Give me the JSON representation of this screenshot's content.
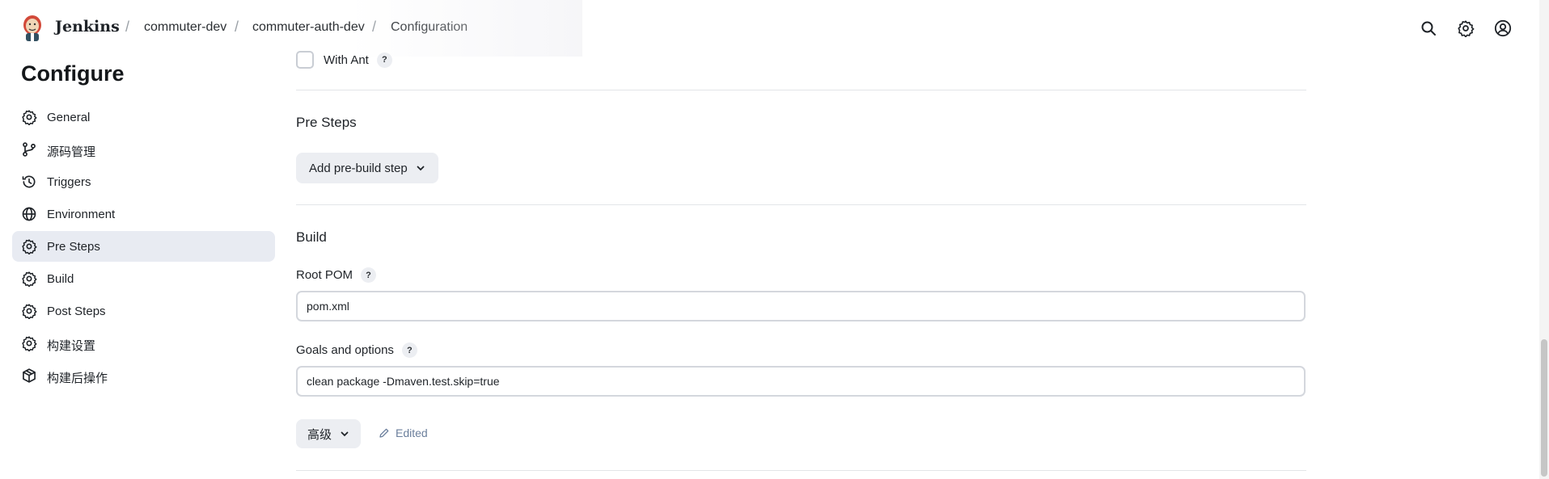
{
  "header": {
    "brand": "Jenkins",
    "breadcrumbs": [
      {
        "label": "commuter-dev"
      },
      {
        "label": "commuter-auth-dev"
      },
      {
        "label": "Configuration"
      }
    ],
    "separator": "/",
    "icons": [
      "search-icon",
      "gear-icon",
      "user-icon"
    ]
  },
  "page": {
    "title": "Configure"
  },
  "sidebar": {
    "items": [
      {
        "label": "General",
        "icon": "gear-icon",
        "active": false
      },
      {
        "label": "源码管理",
        "icon": "branch-icon",
        "active": false
      },
      {
        "label": "Triggers",
        "icon": "clock-icon",
        "active": false
      },
      {
        "label": "Environment",
        "icon": "globe-icon",
        "active": false
      },
      {
        "label": "Pre Steps",
        "icon": "gear-icon",
        "active": true
      },
      {
        "label": "Build",
        "icon": "gear-icon",
        "active": false
      },
      {
        "label": "Post Steps",
        "icon": "gear-icon",
        "active": false
      },
      {
        "label": "构建设置",
        "icon": "gear-icon",
        "active": false
      },
      {
        "label": "构建后操作",
        "icon": "package-icon",
        "active": false
      }
    ]
  },
  "main": {
    "with_ant": {
      "label": "With Ant",
      "checked": false,
      "help": "?"
    },
    "pre_steps": {
      "title": "Pre Steps",
      "add_button": "Add pre-build step"
    },
    "build": {
      "title": "Build",
      "root_pom": {
        "label": "Root POM",
        "help": "?",
        "value": "pom.xml"
      },
      "goals": {
        "label": "Goals and options",
        "help": "?",
        "value": "clean package -Dmaven.test.skip=true"
      },
      "advanced_button": "高级",
      "edited_label": "Edited"
    }
  }
}
